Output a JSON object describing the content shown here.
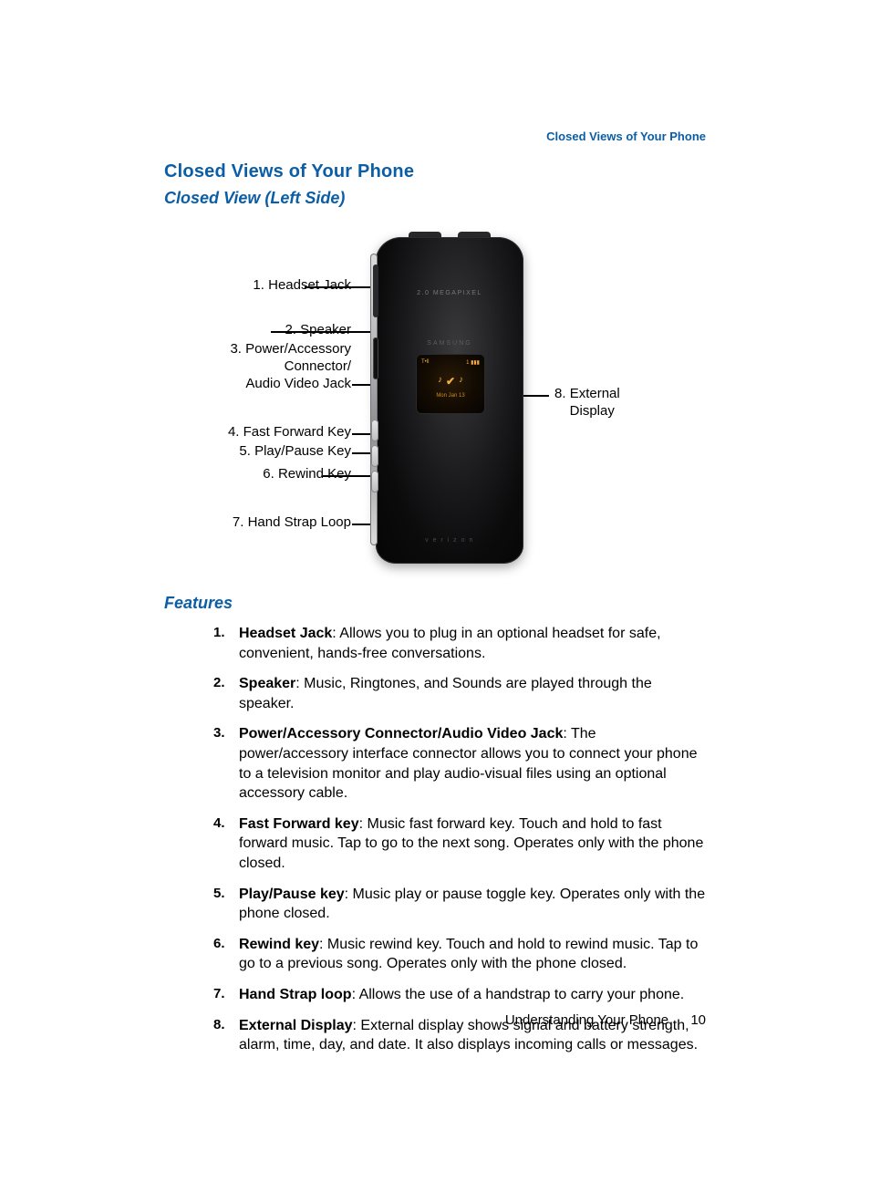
{
  "running_head": "Closed Views of Your Phone",
  "h1": "Closed Views of Your Phone",
  "h2a": "Closed View (Left Side)",
  "h2b": "Features",
  "diagram": {
    "callouts_left": [
      {
        "n": 1,
        "label": "Headset Jack"
      },
      {
        "n": 2,
        "label": "Speaker"
      },
      {
        "n": 3,
        "label_line1": "Power/Accessory",
        "label_line2": "Connector/",
        "label_line3": "Audio Video Jack"
      },
      {
        "n": 4,
        "label": "Fast Forward Key"
      },
      {
        "n": 5,
        "label": "Play/Pause Key"
      },
      {
        "n": 6,
        "label": "Rewind Key"
      },
      {
        "n": 7,
        "label": "Hand Strap Loop"
      }
    ],
    "callouts_right": [
      {
        "n": 8,
        "label_line1": "External",
        "label_line2": "Display"
      }
    ],
    "ext_display": {
      "top_left": "T•ll",
      "top_right": "1  ▮▮▮",
      "date": "Mon Jan 13"
    }
  },
  "features": [
    {
      "term": "Headset Jack",
      "desc": ": Allows you to plug in an optional headset for safe, convenient, hands-free conversations."
    },
    {
      "term": "Speaker",
      "desc": ": Music, Ringtones, and Sounds are played through the speaker."
    },
    {
      "term": "Power/Accessory Connector/Audio Video Jack",
      "desc": ": The power/accessory interface connector allows you to connect your phone to a television monitor and play audio-visual files using an optional accessory cable."
    },
    {
      "term": "Fast Forward key",
      "desc": ": Music fast forward key. Touch and hold to fast forward music. Tap to go to the next song. Operates only with the phone closed."
    },
    {
      "term": "Play/Pause key",
      "desc": ": Music play or pause toggle key. Operates only with the phone closed."
    },
    {
      "term": "Rewind key",
      "desc": ": Music rewind key. Touch and hold to rewind music. Tap to go to a previous song. Operates only with the phone closed."
    },
    {
      "term": "Hand Strap loop",
      "desc": ": Allows the use of a handstrap to carry your phone."
    },
    {
      "term": "External Display",
      "desc": ": External display shows signal and battery strength, alarm, time, day, and date. It also displays incoming calls or messages."
    }
  ],
  "footer": {
    "section": "Understanding Your Phone",
    "page": "10"
  }
}
